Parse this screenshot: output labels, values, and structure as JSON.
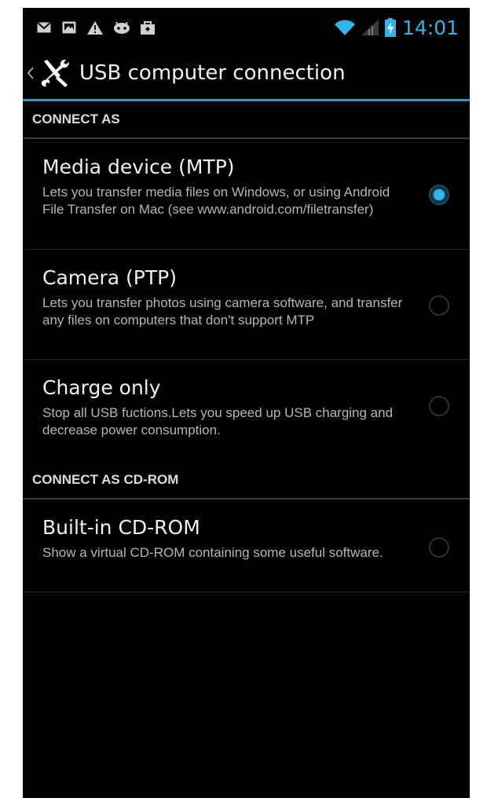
{
  "status_bar": {
    "left_icons": [
      "gmail-icon",
      "gallery-icon",
      "warning-icon",
      "android-debug-icon",
      "shopping-bag-icon"
    ],
    "right_icons": [
      "wifi-icon",
      "signal-icon",
      "battery-charging-icon"
    ],
    "time": "14:01"
  },
  "action_bar": {
    "title": "USB computer connection",
    "app_icon": "settings-tools-icon",
    "up_icon": "back-caret-icon"
  },
  "sections": [
    {
      "header": "CONNECT AS",
      "items": [
        {
          "title": "Media device (MTP)",
          "description": "Lets you transfer media files on Windows, or using Android File Transfer on Mac (see www.android.com/filetransfer)",
          "checked": true
        },
        {
          "title": "Camera (PTP)",
          "description": "Lets you transfer photos using camera software, and transfer any files on computers that don't support MTP",
          "checked": false
        },
        {
          "title": "Charge only",
          "description": "Stop all USB fuctions.Lets you speed up USB charging and decrease power consumption.",
          "checked": false
        }
      ]
    },
    {
      "header": "CONNECT AS CD-ROM",
      "items": [
        {
          "title": "Built-in CD-ROM",
          "description": "Show a virtual CD-ROM containing some useful software.",
          "checked": false
        }
      ]
    }
  ],
  "colors": {
    "accent": "#33b5e5",
    "background": "#000000",
    "title_text": "#f0f0f0",
    "secondary_text": "#b5b5b5"
  }
}
